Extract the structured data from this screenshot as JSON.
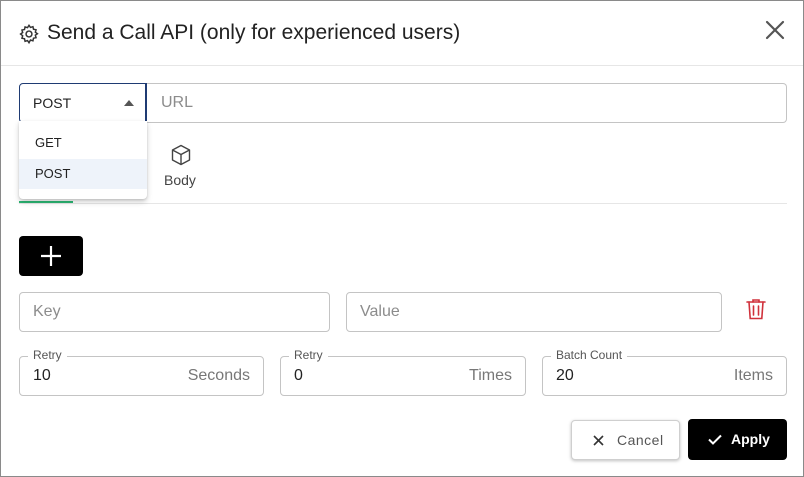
{
  "header": {
    "icon": "gear-icon",
    "title": "Send a Call API (only for experienced users)",
    "close_icon": "close-icon"
  },
  "request": {
    "method": "POST",
    "method_options": [
      "GET",
      "POST"
    ],
    "url_placeholder": "URL"
  },
  "tabs": {
    "body_label": "Body",
    "body_icon": "cube-icon",
    "active_indicator_color": "#2bb673"
  },
  "params": {
    "add_icon": "plus-icon",
    "key_placeholder": "Key",
    "value_placeholder": "Value",
    "delete_icon": "trash-icon",
    "delete_color": "#d0313b"
  },
  "settings": {
    "retry_seconds": {
      "label": "Retry",
      "value": "10",
      "unit": "Seconds"
    },
    "retry_times": {
      "label": "Retry",
      "value": "0",
      "unit": "Times"
    },
    "batch_count": {
      "label": "Batch Count",
      "value": "20",
      "unit": "Items"
    }
  },
  "actions": {
    "cancel_label": "Cancel",
    "apply_label": "Apply"
  }
}
